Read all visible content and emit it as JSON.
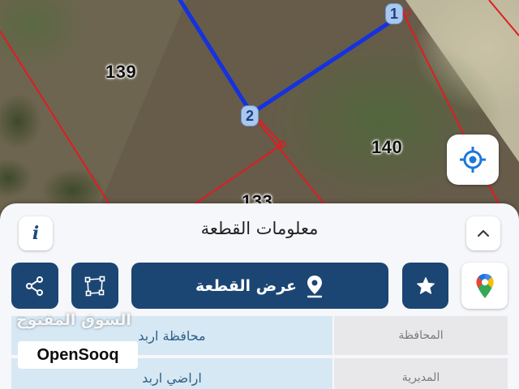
{
  "map": {
    "parcel_labels": [
      "139",
      "140",
      "133"
    ],
    "vertices": [
      "1",
      "2"
    ],
    "colors": {
      "boundary_line": "#e11b22",
      "selected_edge": "#1532e0",
      "vertex_fill": "#a9c8ee"
    }
  },
  "locate_button": {
    "icon": "crosshair-icon",
    "color": "#1e78d8"
  },
  "sheet": {
    "title": "معلومات القطعة",
    "info_label": "i",
    "collapse_icon": "chevron-up-icon",
    "actions": {
      "share_icon": "share-icon",
      "polygon_icon": "polygon-icon",
      "show_parcel_label": "عرض القطعة",
      "show_parcel_icon": "location-pin-icon",
      "favorite_icon": "star-icon",
      "maps_icon": "google-maps-icon"
    },
    "accent_color": "#1b4573",
    "rows": [
      {
        "label": "المحافظة",
        "value": "محافظة اربد"
      },
      {
        "label": "المديرية",
        "value": "اراضي اربد"
      }
    ]
  },
  "watermark": {
    "arabic": "السوق المفتوح",
    "brand": "OpenSooq"
  }
}
